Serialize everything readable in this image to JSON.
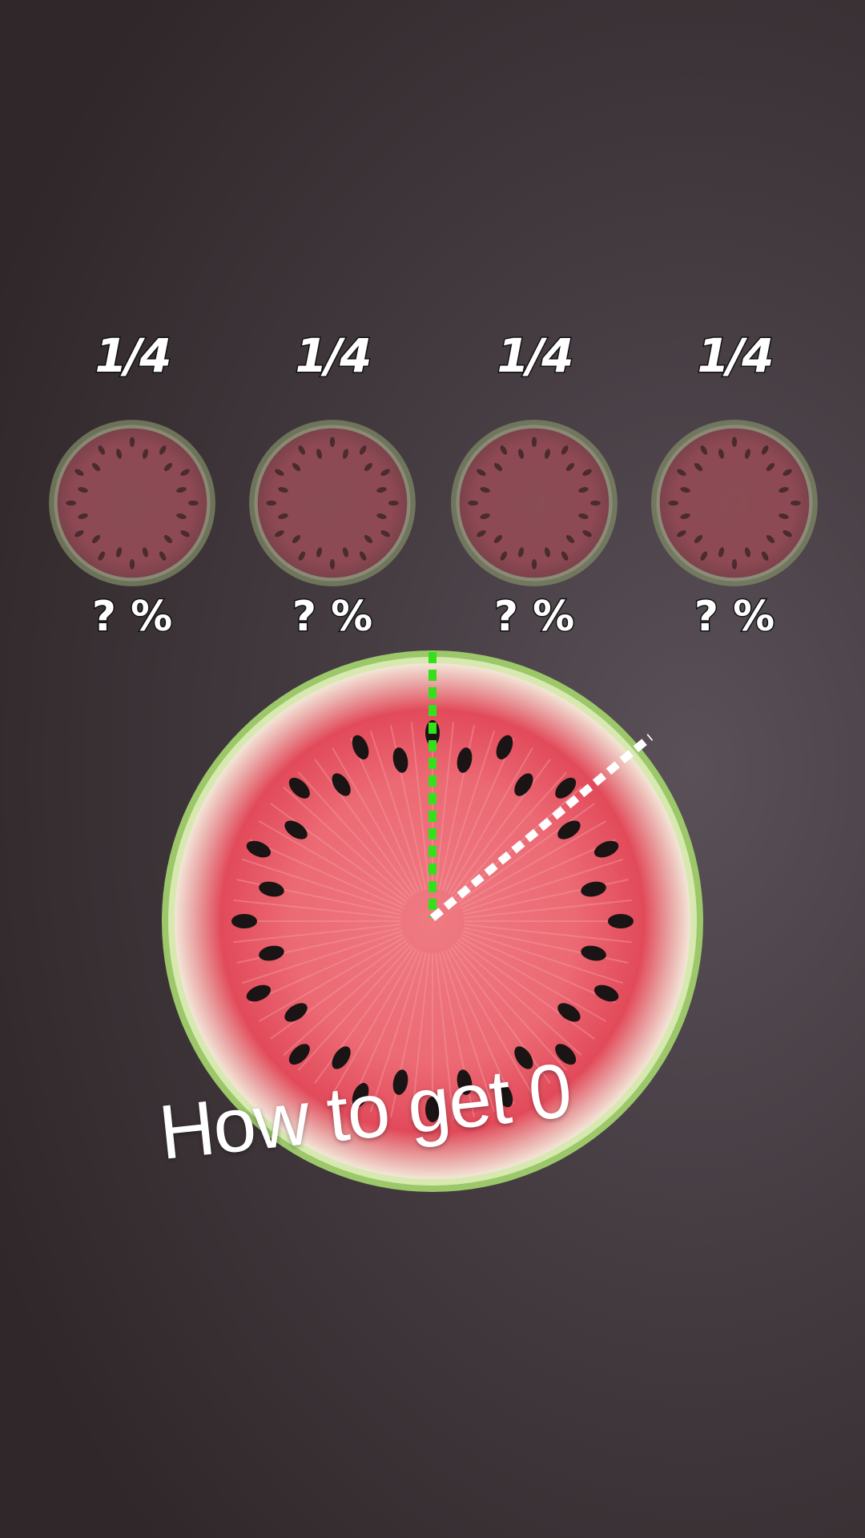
{
  "targets": [
    {
      "fraction": "1/4",
      "percent": "? %"
    },
    {
      "fraction": "1/4",
      "percent": "? %"
    },
    {
      "fraction": "1/4",
      "percent": "? %"
    },
    {
      "fraction": "1/4",
      "percent": "? %"
    }
  ],
  "hint_text": "How to get 0",
  "colors": {
    "cut_line_active": "#33e01a",
    "cut_line_aim": "#ffffff",
    "flesh": "#e8505e",
    "rind": "#9cc86a",
    "seed": "#1a1414"
  },
  "icons": [
    "watermelon-icon",
    "watermelon-faded-icon"
  ]
}
